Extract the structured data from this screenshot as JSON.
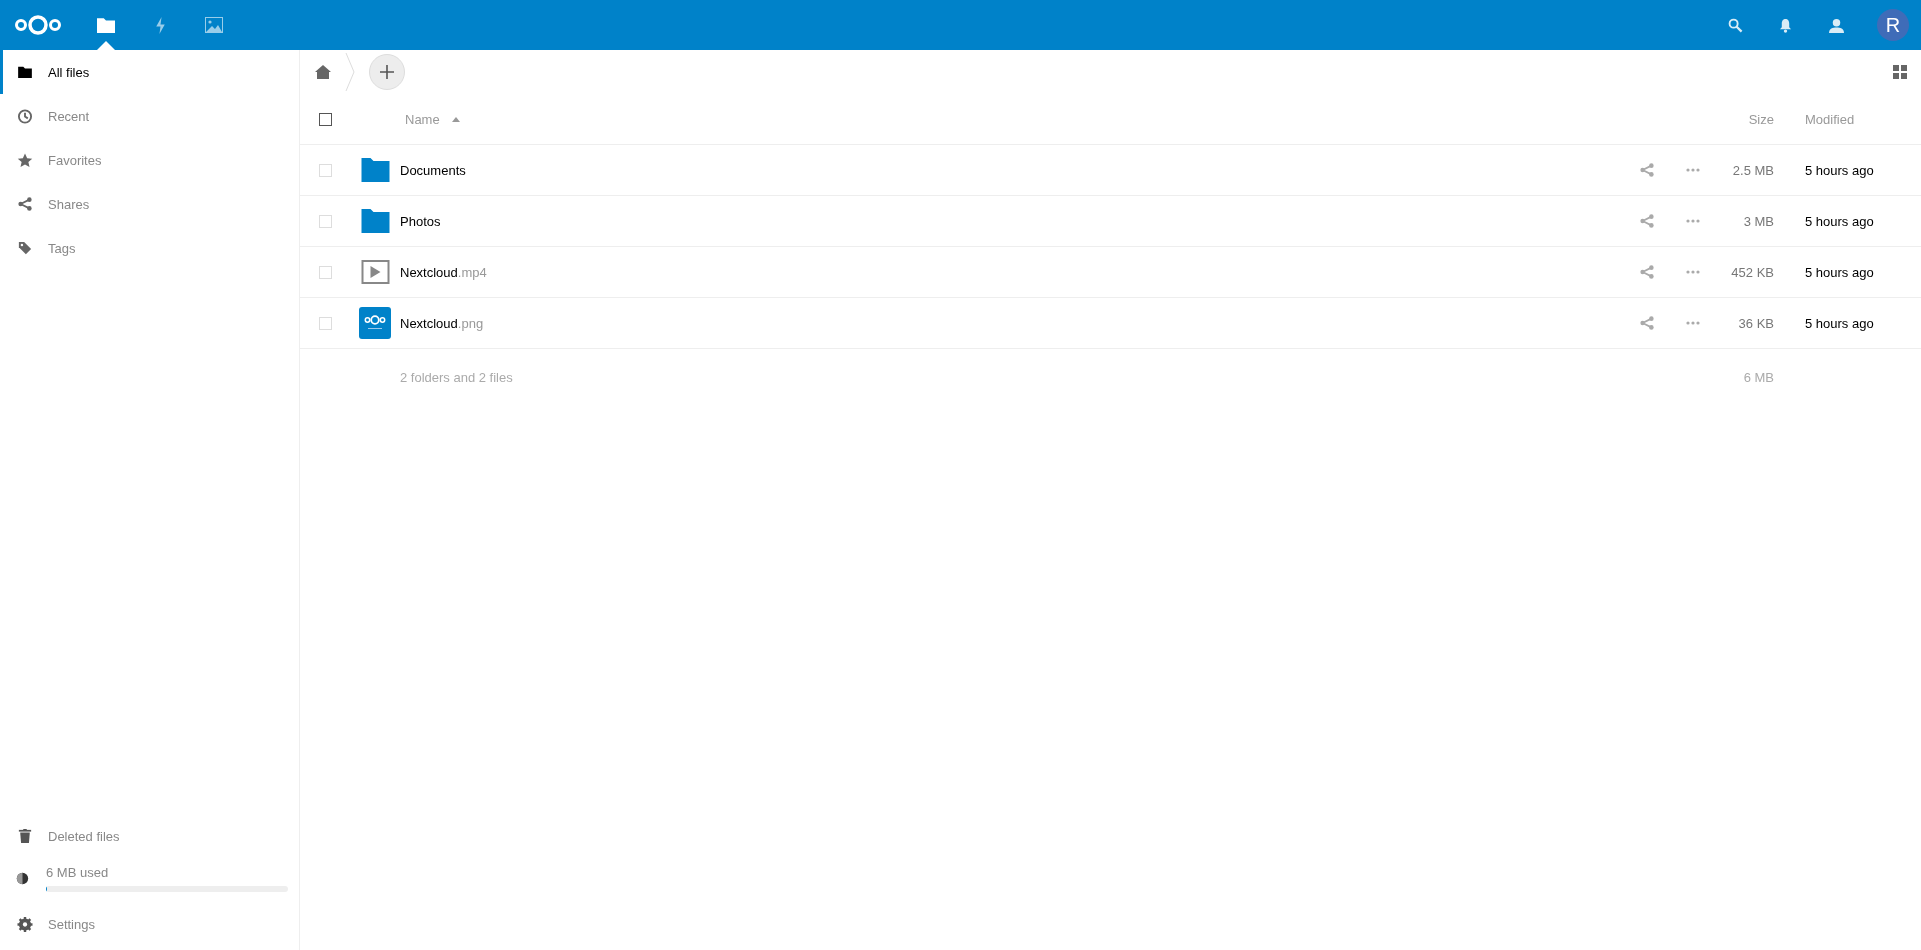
{
  "header": {
    "apps": [
      {
        "kind": "files",
        "selected": true
      },
      {
        "kind": "activity",
        "selected": false
      },
      {
        "kind": "gallery",
        "selected": false
      }
    ],
    "avatar": "R"
  },
  "sidebar": {
    "items": [
      {
        "kind": "folder",
        "label": "All files",
        "selected": true
      },
      {
        "kind": "clock",
        "label": "Recent",
        "selected": false
      },
      {
        "kind": "star",
        "label": "Favorites",
        "selected": false
      },
      {
        "kind": "share",
        "label": "Shares",
        "selected": false
      },
      {
        "kind": "tag",
        "label": "Tags",
        "selected": false
      }
    ],
    "deleted_files": "Deleted files",
    "quota": {
      "label": "6 MB used",
      "level": 0.005
    },
    "settings": "Settings"
  },
  "table": {
    "select_all_checked": false,
    "columns": {
      "name": "Name",
      "size": "Size",
      "modified": "Modified"
    },
    "rows": [
      {
        "kind": "folder",
        "name": "Documents",
        "extension": "",
        "checked": false,
        "size": "2.5 MB",
        "modified": "5 hours ago"
      },
      {
        "kind": "folder",
        "name": "Photos",
        "extension": "",
        "checked": false,
        "size": "3 MB",
        "modified": "5 hours ago"
      },
      {
        "kind": "video",
        "name": "Nextcloud",
        "extension": ".mp4",
        "checked": false,
        "size": "452 KB",
        "modified": "5 hours ago"
      },
      {
        "kind": "image",
        "name": "Nextcloud",
        "extension": ".png",
        "checked": false,
        "size": "36 KB",
        "modified": "5 hours ago"
      }
    ],
    "summary": "2 folders and 2 files",
    "total_size": "6 MB"
  }
}
